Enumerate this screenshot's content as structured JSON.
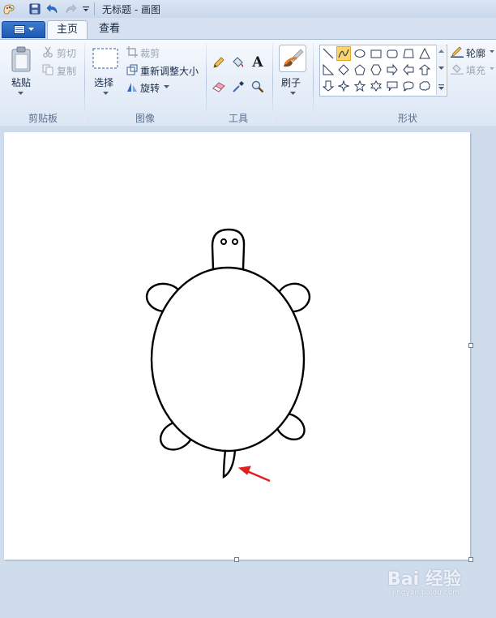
{
  "window": {
    "title": "无标题 - 画图"
  },
  "tabs": [
    {
      "label": "主页",
      "active": true
    },
    {
      "label": "查看",
      "active": false
    }
  ],
  "clipboard": {
    "paste": "粘贴",
    "cut": "剪切",
    "copy": "复制",
    "label": "剪贴板"
  },
  "image": {
    "select": "选择",
    "crop": "裁剪",
    "resize": "重新调整大小",
    "rotate": "旋转",
    "label": "图像"
  },
  "tools": {
    "label": "工具",
    "text_tool_glyph": "A"
  },
  "brushes": {
    "label": "刷子"
  },
  "shapes": {
    "label": "形状",
    "outline": "轮廓",
    "fill": "填充"
  },
  "watermark": {
    "main": "Bai 经验",
    "sub": "jingyan.baidu.com"
  },
  "colors": {
    "accent": "#1d59b3",
    "selected_shape": "#fbd46b",
    "arrow": "#e02020"
  }
}
